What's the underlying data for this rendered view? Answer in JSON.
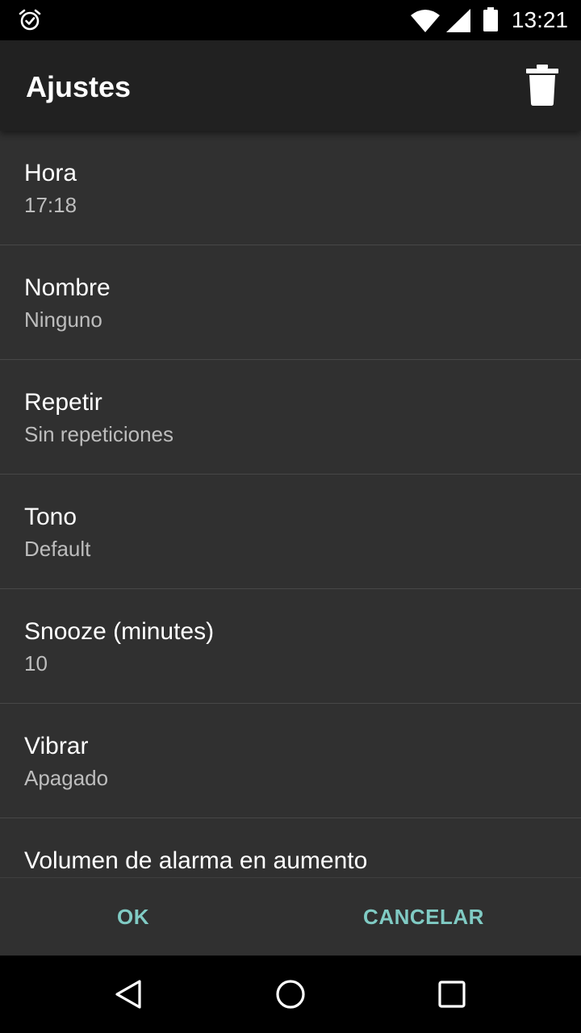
{
  "status_bar": {
    "time": "13:21",
    "icons": [
      "alarm-icon",
      "wifi-icon",
      "signal-icon",
      "battery-icon"
    ]
  },
  "app_bar": {
    "title": "Ajustes",
    "action_icon": "trash-icon"
  },
  "settings": [
    {
      "label": "Hora",
      "value": "17:18"
    },
    {
      "label": "Nombre",
      "value": "Ninguno"
    },
    {
      "label": "Repetir",
      "value": "Sin repeticiones"
    },
    {
      "label": "Tono",
      "value": "Default"
    },
    {
      "label": "Snooze (minutes)",
      "value": "10"
    },
    {
      "label": "Vibrar",
      "value": "Apagado"
    },
    {
      "label": "Volumen de alarma en aumento",
      "value": ""
    }
  ],
  "buttons": {
    "ok": "OK",
    "cancel": "CANCELAR"
  },
  "nav": {
    "icons": [
      "back-icon",
      "home-icon",
      "recents-icon"
    ]
  },
  "colors": {
    "background": "#303030",
    "app_bar": "#212121",
    "accent": "#80cbc4"
  }
}
